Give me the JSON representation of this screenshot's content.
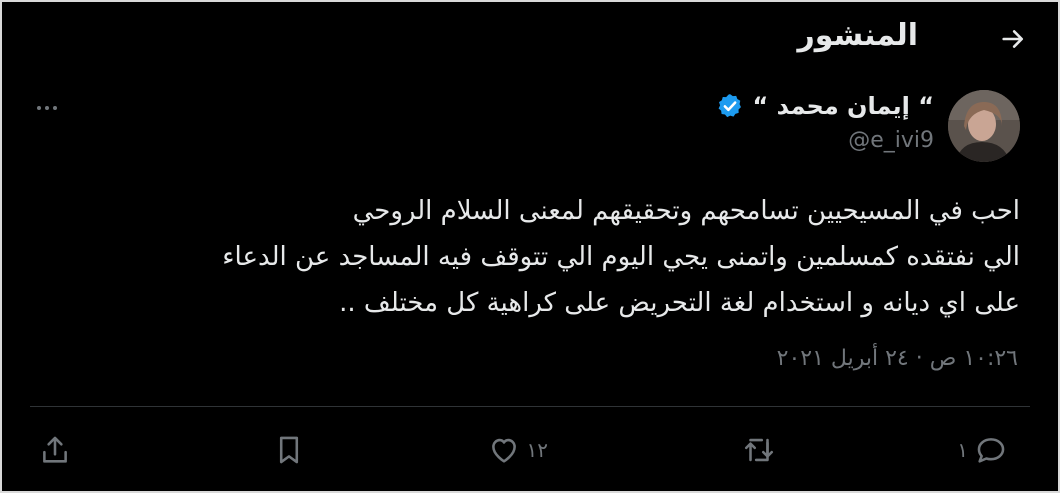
{
  "header": {
    "title": "المنشور",
    "back_icon": "arrow-right-icon"
  },
  "author": {
    "display_name": "“ إيمان محمد “",
    "handle": "@e_ivi9",
    "verified_icon": "verified-badge-icon",
    "verified_color": "#1d9bf0"
  },
  "tweet": {
    "text": "احب في المسيحيين تسامحهم وتحقيقهم لمعنى السلام الروحي\nالي نفتقده كمسلمين واتمنى يجي اليوم الي تتوقف فيه المساجد عن الدعاء\nعلى اي ديانه و استخدام لغة التحريض على كراهية كل مختلف ..",
    "timestamp": "١٠:٢٦ ص · ٢٤ أبريل ٢٠٢١"
  },
  "actions": {
    "reply_count": "١",
    "retweet_count": "",
    "like_count": "١٢",
    "bookmark_count": "",
    "reply_icon": "reply-icon",
    "retweet_icon": "retweet-icon",
    "like_icon": "heart-icon",
    "bookmark_icon": "bookmark-icon",
    "share_icon": "share-icon"
  },
  "colors": {
    "background": "#000000",
    "text": "#e7e9ea",
    "muted": "#71767b",
    "divider": "#2f3336"
  }
}
